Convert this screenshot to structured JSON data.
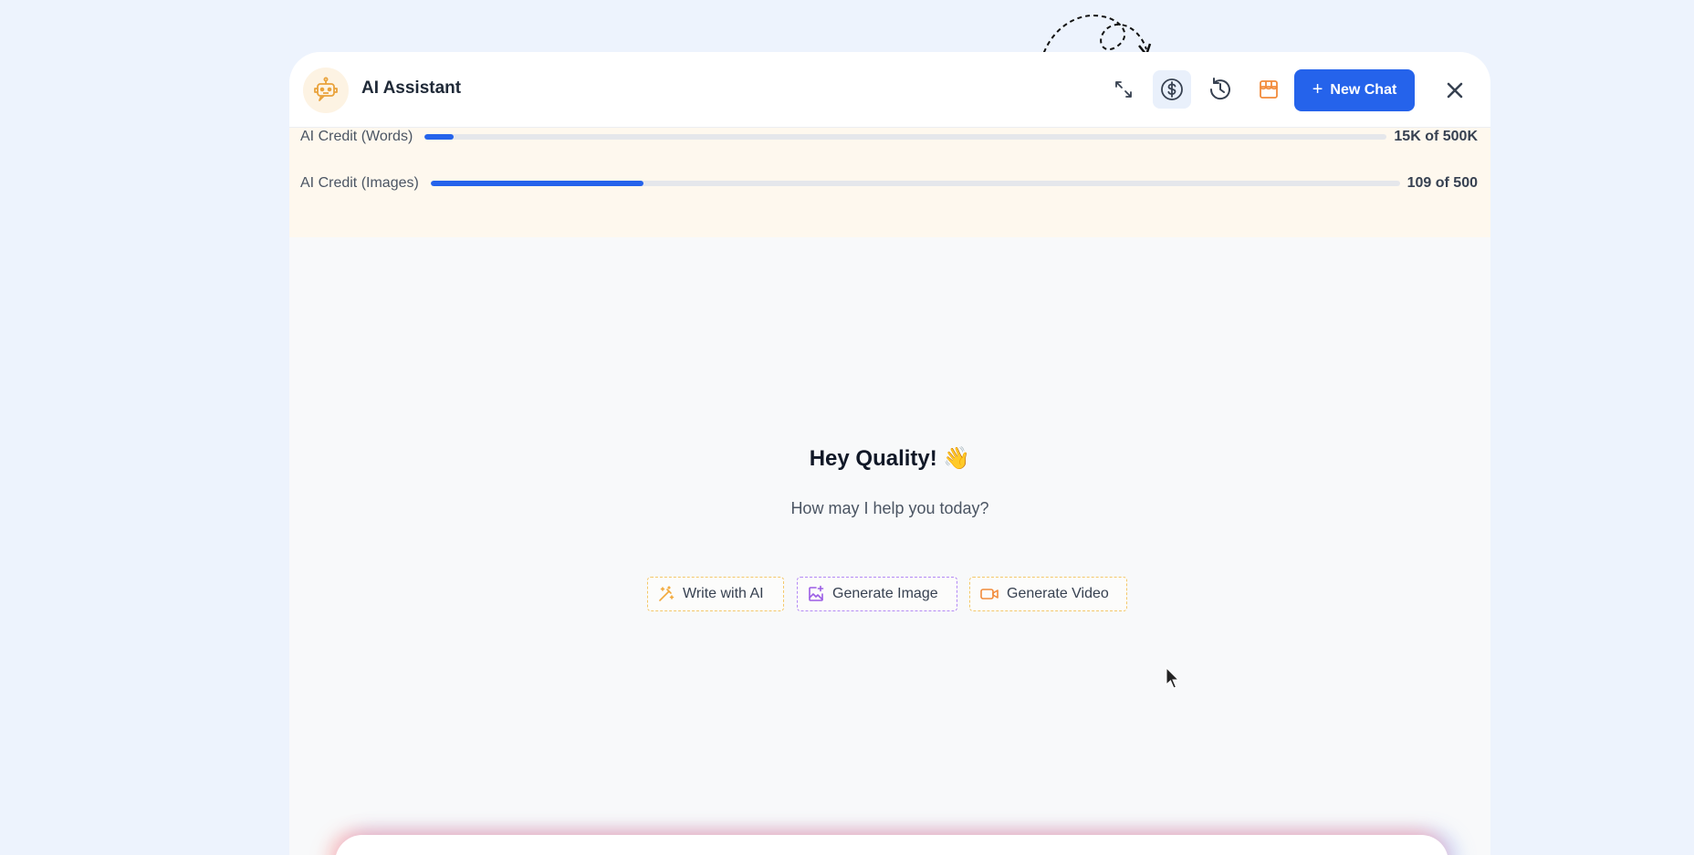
{
  "header": {
    "title": "AI Assistant",
    "new_chat_label": "New Chat",
    "icons": [
      "expand-icon",
      "dollar-icon",
      "history-icon",
      "store-icon",
      "close-icon"
    ]
  },
  "credits": [
    {
      "label": "AI Credit (Words)",
      "value": "15K of 500K",
      "progress": 0.03
    },
    {
      "label": "AI Credit (Images)",
      "value": "109 of 500",
      "progress": 0.22
    }
  ],
  "main": {
    "greeting": "Hey Quality! 👋",
    "subtitle": "How may I help you today?",
    "actions": [
      {
        "label": "Write with AI",
        "icon": "magic-wand-icon",
        "color": "#f2a93b"
      },
      {
        "label": "Generate Image",
        "icon": "image-sparkle-icon",
        "color": "#9b5de5"
      },
      {
        "label": "Generate Video",
        "icon": "video-icon",
        "color": "#f28b3b"
      }
    ]
  },
  "colors": {
    "accent": "#2563eb",
    "page_background": "#edf3fd",
    "credit_background": "#fef8ee"
  }
}
